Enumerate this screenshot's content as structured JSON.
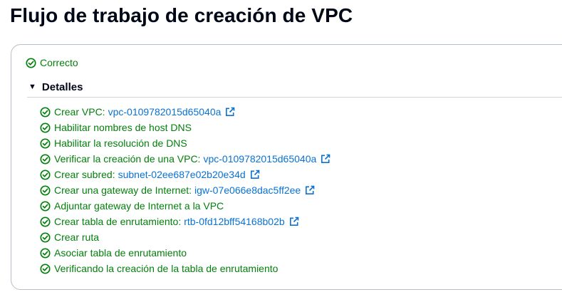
{
  "title": "Flujo de trabajo de creación de VPC",
  "status": {
    "label": "Correcto",
    "icon": "status-success-icon"
  },
  "details": {
    "label": "Detalles",
    "expanded": true,
    "icon": "caret-down-icon"
  },
  "colors": {
    "success": "#037f0c",
    "link": "#0972d3",
    "text": "#000716",
    "border": "#b6bec9"
  },
  "steps": [
    {
      "text": "Crear VPC:",
      "link": "vpc-0109782015d65040a",
      "external": true
    },
    {
      "text": "Habilitar nombres de host DNS"
    },
    {
      "text": "Habilitar la resolución de DNS"
    },
    {
      "text": "Verificar la creación de una VPC:",
      "link": "vpc-0109782015d65040a",
      "external": true
    },
    {
      "text": "Crear subred:",
      "link": "subnet-02ee687e02b20e34d",
      "external": true
    },
    {
      "text": "Crear una gateway de Internet:",
      "link": "igw-07e066e8dac5ff2ee",
      "external": true
    },
    {
      "text": "Adjuntar gateway de Internet a la VPC"
    },
    {
      "text": "Crear tabla de enrutamiento:",
      "link": "rtb-0fd12bff54168b02b",
      "external": true
    },
    {
      "text": "Crear ruta"
    },
    {
      "text": "Asociar tabla de enrutamiento"
    },
    {
      "text": "Verificando la creación de la tabla de enrutamiento"
    }
  ]
}
